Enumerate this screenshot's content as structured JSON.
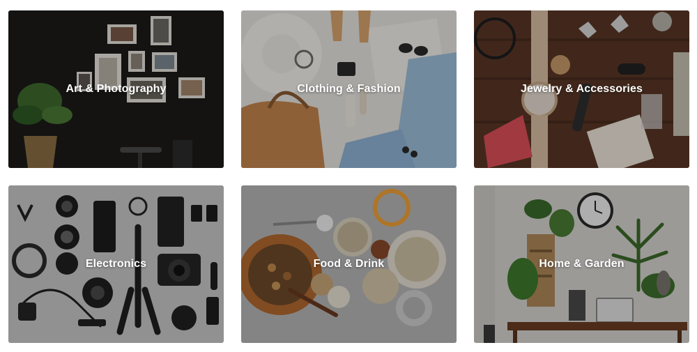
{
  "categories": [
    {
      "label": "Art & Photography",
      "image": "framed-photos-on-dark-wall"
    },
    {
      "label": "Clothing & Fashion",
      "image": "hat-bag-jeans-flatlay"
    },
    {
      "label": "Jewelry & Accessories",
      "image": "watch-rings-on-wood"
    },
    {
      "label": "Electronics",
      "image": "camera-gear-flatlay"
    },
    {
      "label": "Food & Drink",
      "image": "nuts-and-jars-on-grey"
    },
    {
      "label": "Home & Garden",
      "image": "plants-shelf-and-desk"
    }
  ]
}
